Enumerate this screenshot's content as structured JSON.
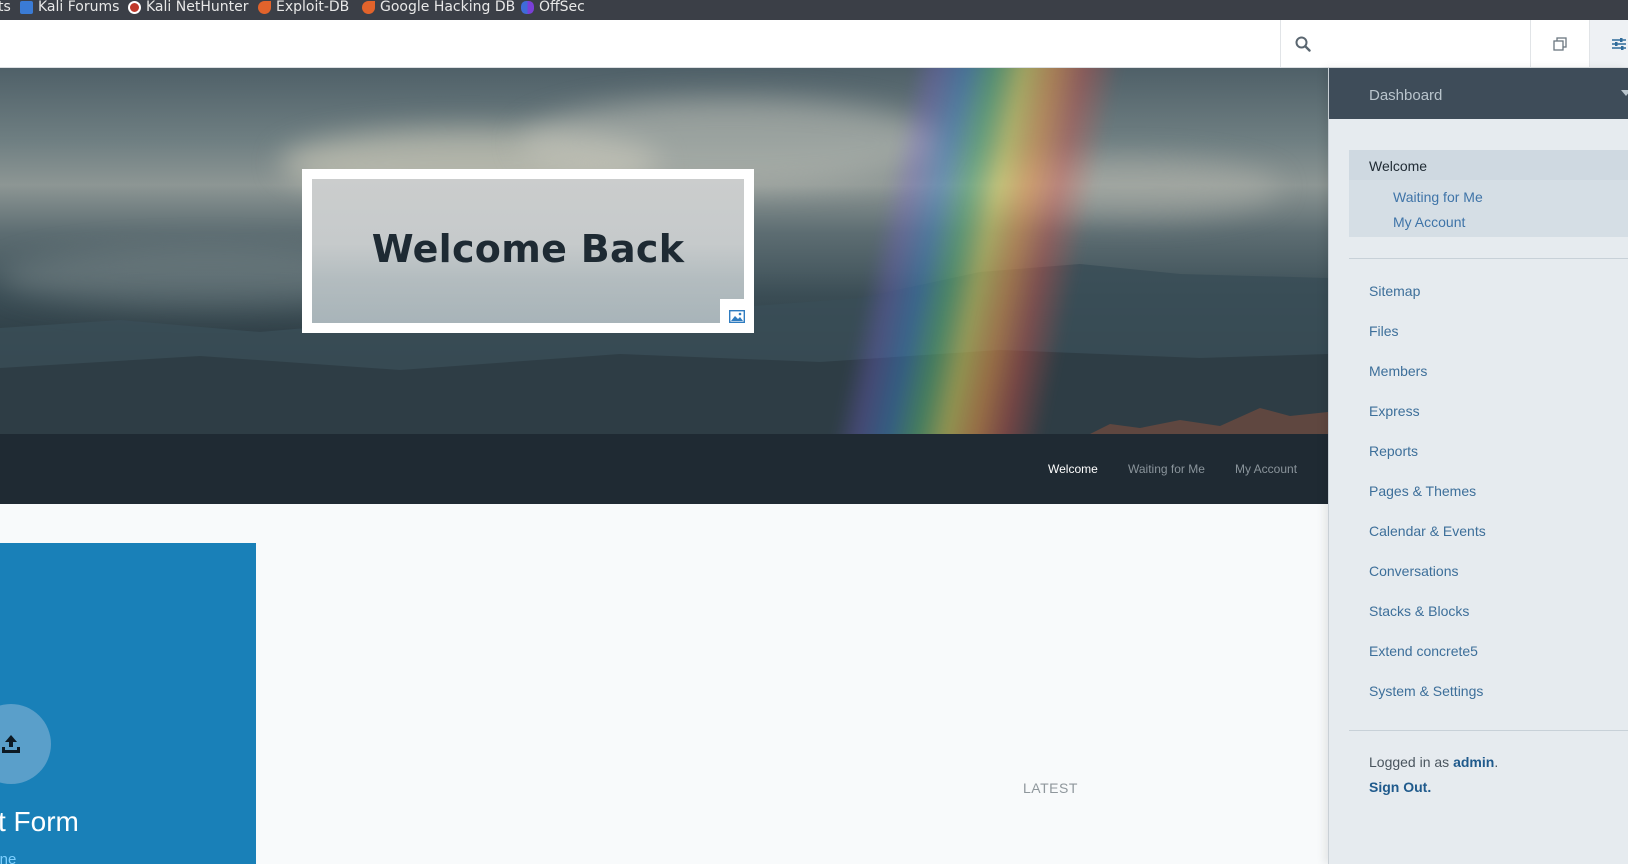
{
  "bookmarks": [
    {
      "label": "ts",
      "icon": "none"
    },
    {
      "label": "Kali Forums",
      "icon": "kali-forums-icon"
    },
    {
      "label": "Kali NetHunter",
      "icon": "kali-nethunter-icon"
    },
    {
      "label": "Exploit-DB",
      "icon": "exploit-db-icon"
    },
    {
      "label": "Google Hacking DB",
      "icon": "google-hacking-db-icon"
    },
    {
      "label": "OffSec",
      "icon": "offsec-icon"
    }
  ],
  "toolbar": {
    "search_placeholder": "",
    "icons": [
      "search-icon",
      "copy-icon",
      "sliders-icon"
    ]
  },
  "hero": {
    "title": "Welcome Back",
    "image_badge_icon": "image-icon"
  },
  "nav": {
    "items": [
      {
        "label": "Welcome",
        "active": true
      },
      {
        "label": "Waiting for Me",
        "active": false
      },
      {
        "label": "My Account",
        "active": false
      }
    ]
  },
  "card": {
    "title": "st Form",
    "subtitle": "lone",
    "icon": "upload-icon",
    "color": "#1980b8"
  },
  "latest_label": "LATEST",
  "panel": {
    "header": "Dashboard",
    "current": "Welcome",
    "current_children": [
      "Waiting for Me",
      "My Account"
    ],
    "items": [
      "Sitemap",
      "Files",
      "Members",
      "Express",
      "Reports",
      "Pages & Themes",
      "Calendar & Events",
      "Conversations",
      "Stacks & Blocks",
      "Extend concrete5",
      "System & Settings"
    ],
    "logged_in_prefix": "Logged in as ",
    "user": "admin",
    "logged_in_suffix": ".",
    "sign_out": "Sign Out."
  },
  "colors": {
    "nav_bg": "#1f2a33",
    "panel_head_bg": "#3e4c59",
    "link": "#3d6f9a",
    "card_blue": "#1980b8"
  }
}
